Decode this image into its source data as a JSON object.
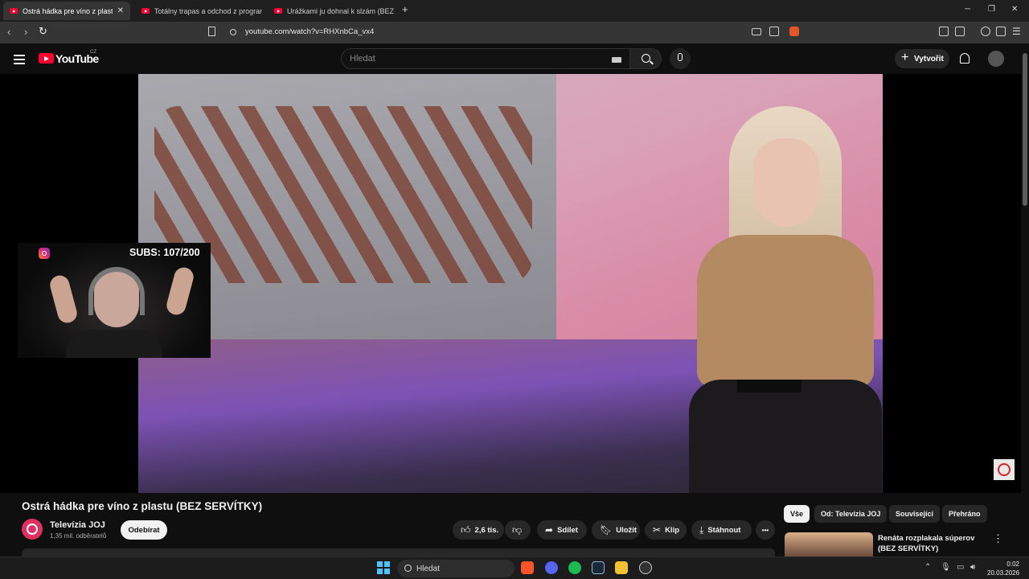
{
  "browser": {
    "tabs": [
      {
        "title": "Ostrá hádka pre víno z plastu (B",
        "active": true,
        "close": "✕"
      },
      {
        "title": "Totálny trapas a odchod z programu",
        "active": false
      },
      {
        "title": "Urážkami ju dohnal k slzám (BEZ SER",
        "active": false
      }
    ],
    "new_tab": "+",
    "window_controls": {
      "minimize": "─",
      "restore": "❐",
      "close": "✕"
    },
    "url": "youtube.com/watch?v=RHXnbCa_vx4",
    "nav": {
      "back": "‹",
      "forward": "›",
      "reload": "↻"
    }
  },
  "youtube": {
    "logo_text": "YouTube",
    "country": "CZ",
    "search_placeholder": "Hledat",
    "create_label": "Vytvořit"
  },
  "video": {
    "overlay_subs": "SUBS: 107/200"
  },
  "watch": {
    "title": "Ostrá hádka pre víno z plastu (BEZ SERVÍTKY)",
    "channel_name": "Televízia JOJ",
    "subscribers": "1,35 mil. odběratelů",
    "subscribe_label": "Odebírat",
    "actions": {
      "likes": "2,6 tis.",
      "share": "Sdílet",
      "save": "Uložit",
      "clip": "Klip",
      "download": "Stáhnout",
      "more": "•••"
    }
  },
  "sidebar": {
    "chips": [
      "Vše",
      "Od: Televízia JOJ",
      "Související",
      "Přehráno"
    ],
    "recommendation_title": "Renáta rozplakala súperov (BEZ SERVÍTKY)",
    "recommendation_more": "⋮"
  },
  "taskbar": {
    "search_label": "Hledat",
    "time": "0:02",
    "date": "20.03.2026"
  },
  "colors": {
    "youtube_red": "#ff0033",
    "background": "#0f0f0f",
    "button_bg": "#272727"
  }
}
